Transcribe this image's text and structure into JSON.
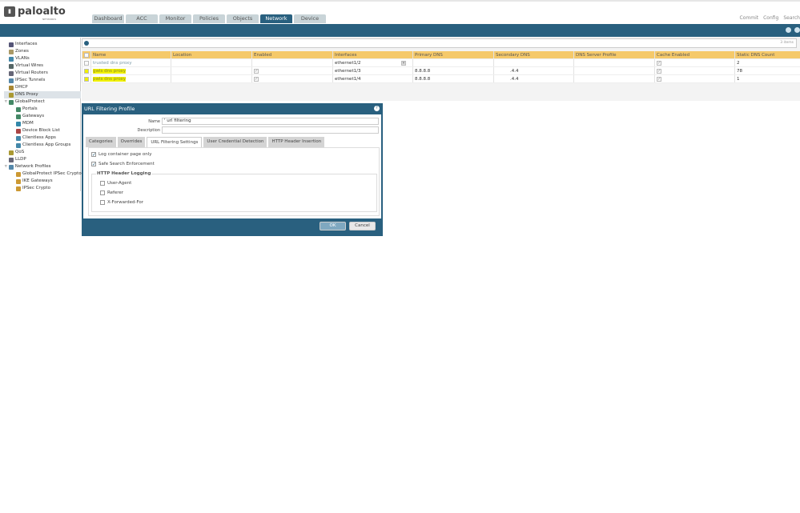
{
  "brand": {
    "name": "paloalto",
    "sub": "NETWORKS"
  },
  "tabs": [
    "Dashboard",
    "ACC",
    "Monitor",
    "Policies",
    "Objects",
    "Network",
    "Device"
  ],
  "active_tab": "Network",
  "top_actions": [
    "Commit",
    "Config",
    "Search"
  ],
  "sidebar": [
    {
      "label": "Interfaces",
      "indent": 0,
      "color": "#557"
    },
    {
      "label": "Zones",
      "indent": 0,
      "color": "#a96"
    },
    {
      "label": "VLANs",
      "indent": 0,
      "color": "#48a"
    },
    {
      "label": "Virtual Wires",
      "indent": 0,
      "color": "#566"
    },
    {
      "label": "Virtual Routers",
      "indent": 0,
      "color": "#667"
    },
    {
      "label": "IPSec Tunnels",
      "indent": 0,
      "color": "#58a"
    },
    {
      "label": "DHCP",
      "indent": 0,
      "color": "#a83"
    },
    {
      "label": "DNS Proxy",
      "indent": 0,
      "color": "#a93",
      "selected": true
    },
    {
      "label": "GlobalProtect",
      "indent": 0,
      "color": "#486",
      "expander": "▿"
    },
    {
      "label": "Portals",
      "indent": 1,
      "color": "#486"
    },
    {
      "label": "Gateways",
      "indent": 1,
      "color": "#486"
    },
    {
      "label": "MDM",
      "indent": 1,
      "color": "#38a"
    },
    {
      "label": "Device Block List",
      "indent": 1,
      "color": "#a44"
    },
    {
      "label": "Clientless Apps",
      "indent": 1,
      "color": "#48a"
    },
    {
      "label": "Clientless App Groups",
      "indent": 1,
      "color": "#48a"
    },
    {
      "label": "QoS",
      "indent": 0,
      "color": "#a93"
    },
    {
      "label": "LLDP",
      "indent": 0,
      "color": "#667"
    },
    {
      "label": "Network Profiles",
      "indent": 0,
      "color": "#58a",
      "expander": "▿"
    },
    {
      "label": "GlobalProtect IPSec Crypto",
      "indent": 1,
      "color": "#c93"
    },
    {
      "label": "IKE Gateways",
      "indent": 1,
      "color": "#c93"
    },
    {
      "label": "IPSec Crypto",
      "indent": 1,
      "color": "#c93"
    }
  ],
  "grid": {
    "item_count": "3 items",
    "columns": [
      "Name",
      "Location",
      "Enabled",
      "Interfaces",
      "Primary DNS",
      "Secondary DNS",
      "DNS Server Profile",
      "Cache Enabled",
      "Static DNS Count"
    ],
    "rows": [
      {
        "name": "trusted dns proxy",
        "location": "",
        "enabled": false,
        "interfaces": "ethernet1/2",
        "primary": "",
        "secondary": "",
        "profile": "",
        "cache": true,
        "static": "2",
        "highlight": false
      },
      {
        "name": "gwls dns proxy",
        "location": "",
        "enabled": true,
        "interfaces": "ethernet1/3",
        "primary": "8.8.8.8",
        "secondary": ".4.4",
        "profile": "",
        "cache": true,
        "static": "78",
        "highlight": true
      },
      {
        "name": "pwls dns proxy",
        "location": "",
        "enabled": true,
        "interfaces": "ethernet1/4",
        "primary": "8.8.8.8",
        "secondary": ".4.4",
        "profile": "",
        "cache": true,
        "static": "1",
        "highlight": true
      }
    ]
  },
  "dialog": {
    "title": "URL Filtering Profile",
    "name_label": "Name",
    "name_value": "' url filtering",
    "description_label": "Description",
    "description_value": "",
    "tabs": [
      "Categories",
      "Overrides",
      "URL Filtering Settings",
      "User Credential Detection",
      "HTTP Header Insertion"
    ],
    "active_tab": "URL Filtering Settings",
    "log_container": {
      "label": "Log container page only",
      "checked": true
    },
    "safe_search": {
      "label": "Safe Search Enforcement",
      "checked": true
    },
    "header_logging": {
      "legend": "HTTP Header Logging",
      "items": [
        {
          "label": "User-Agent",
          "checked": false
        },
        {
          "label": "Referer",
          "checked": false
        },
        {
          "label": "X-Forwarded-For",
          "checked": false
        }
      ]
    },
    "ok": "OK",
    "cancel": "Cancel"
  },
  "colors": {
    "accent": "#29607f",
    "grid_header": "#f5c96a",
    "highlight": "#f0f000"
  }
}
